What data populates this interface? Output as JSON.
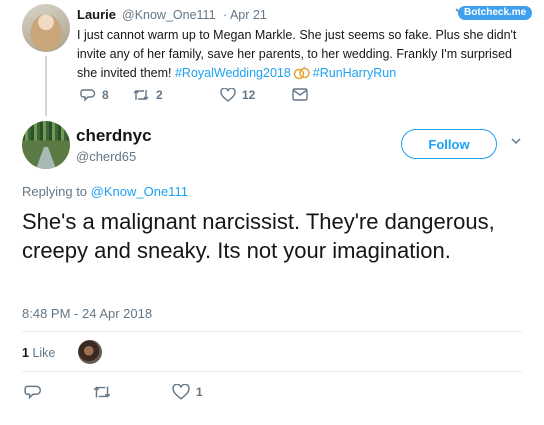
{
  "parent_tweet": {
    "name": "Laurie",
    "handle": "@Know_One111",
    "date": "· Apr 21",
    "badge": "Botcheck.me",
    "text_before_ring": "I just cannot warm up to Megan Markle. She just seems so fake. Plus she didn't invite any of her family, save her parents, to her wedding. Frankly I'm surprised she invited them! ",
    "hashtag1": "#RoyalWedding2018",
    "hashtag2": "#RunHarryRun",
    "replies": "8",
    "retweets": "2",
    "likes": "12"
  },
  "main_tweet": {
    "name": "cherdnyc",
    "handle": "@cherd65",
    "follow_label": "Follow",
    "replying_to_prefix": "Replying to ",
    "replying_to_handle": "@Know_One111",
    "text": "She's a malignant narcissist. They're dangerous, creepy and sneaky. Its not your imagination.",
    "timestamp": "8:48 PM - 24 Apr 2018",
    "likes_count": "1",
    "likes_label": "Like",
    "action_likes": "1"
  },
  "colors": {
    "accent": "#1da1f2",
    "muted": "#657786",
    "text": "#14171a",
    "badge": "#3fa0f0"
  },
  "icons": [
    "reply-icon",
    "retweet-icon",
    "heart-icon",
    "message-icon",
    "chevron-down-icon",
    "wedding-rings-icon"
  ]
}
